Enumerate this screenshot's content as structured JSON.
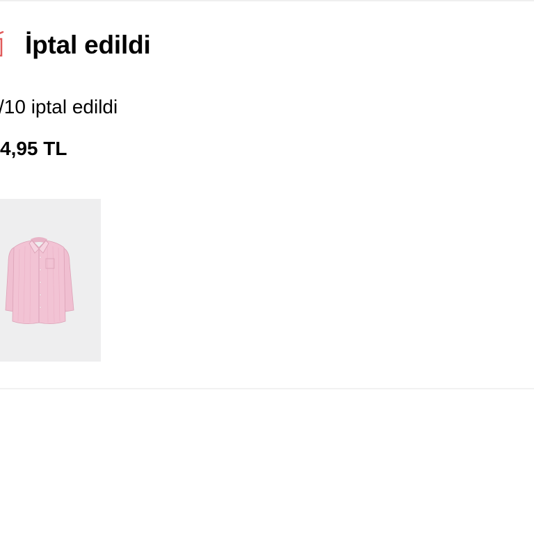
{
  "order": {
    "status_title": "İptal edildi",
    "status_icon": "cancel-box-icon",
    "cancel_count_text": "/10 iptal edildi",
    "price_text": "4,95 TL",
    "status_color": "#e05a5a",
    "product": {
      "image": "pink-shirt-image",
      "shirt_color": "#f2c3d4"
    }
  }
}
